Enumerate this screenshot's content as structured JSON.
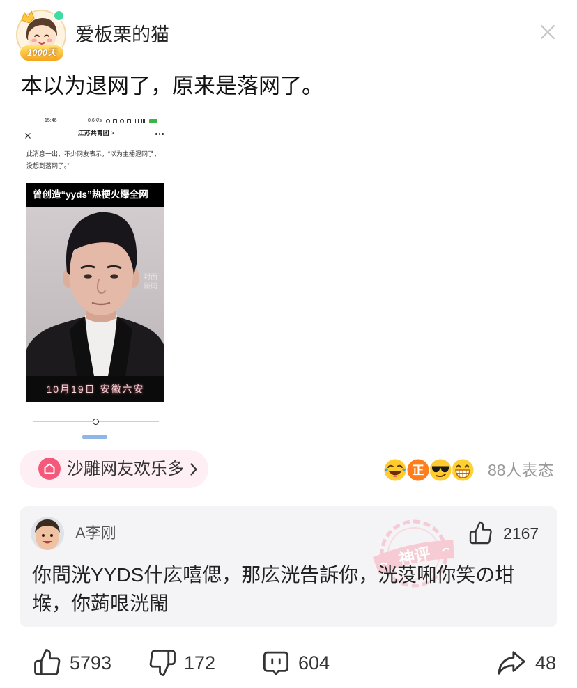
{
  "theme": {
    "accent": "#f4597c",
    "topic_bg": "#fdeff3",
    "comment_bg": "#f4f4f6",
    "muted_text": "#999999"
  },
  "header": {
    "author_name": "爱板栗的猫",
    "avatar_badge": "1000天",
    "close_icon": "close-icon"
  },
  "post": {
    "text": "本以为退网了，原来是落网了。",
    "image": {
      "status_time": "15:46",
      "status_speed": "0.6K/s",
      "account_name": "江苏共青团 >",
      "quote_line1": "此消息一出，不少网友表示，“以为主播退网了，",
      "quote_line2": "没想到落网了。”",
      "video_title": "曾创造“yyds”热梗火爆全网",
      "video_caption": "10月19日 安徽六安",
      "watermark_line1": "封面",
      "watermark_line2": "新闻"
    }
  },
  "topic": {
    "label": "沙雕网友欢乐多",
    "icon": "topic-home-icon",
    "chevron_icon": "chevron-right-icon"
  },
  "reactions": {
    "emojis": [
      "laughing-tears-emoji",
      "zheng-badge-emoji",
      "sunglasses-emoji",
      "grinning-emoji"
    ],
    "zheng_badge_text": "正",
    "count_label": "88人表态"
  },
  "top_comment": {
    "author": "A李刚",
    "like_icon": "thumbs-up-icon",
    "likes": "2167",
    "text_line1": "你問洸YYDS什庅嘻偲，那庅洸告訴你，洸莈啝你笑の坩",
    "text_line2": "堠，你蒟哏洸閙",
    "stamp": "神评"
  },
  "actions": {
    "like": {
      "icon": "thumbs-up-icon",
      "count": "5793"
    },
    "dislike": {
      "icon": "thumbs-down-icon",
      "count": "172"
    },
    "comment": {
      "icon": "comment-icon",
      "count": "604"
    },
    "share": {
      "icon": "share-icon",
      "count": "48"
    }
  }
}
